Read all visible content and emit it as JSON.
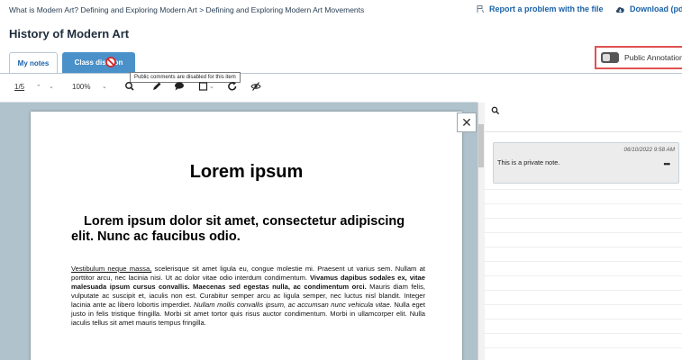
{
  "breadcrumb": "What is Modern Art? Defining and Exploring Modern Art > Defining and Exploring Modern Art Movements",
  "header": {
    "report_label": "Report a problem with the file",
    "download_label": "Download (pdf)"
  },
  "page_title": "History of Modern Art",
  "tabs": [
    {
      "label": "My notes",
      "active": true
    },
    {
      "label": "Class discussion",
      "label_visible": "Class disc  ion",
      "disabled": true
    }
  ],
  "tooltip": "Public comments are disabled for this item",
  "public_annotations_label": "Public Annotations",
  "toolbar": {
    "page_count": "1/5",
    "zoom": "100%",
    "icons": [
      "search-icon",
      "pen-icon",
      "comment-icon",
      "shape-icon",
      "rotate-icon",
      "hide-annotations-icon"
    ]
  },
  "document": {
    "title": "Lorem ipsum",
    "subtitle_line1": "Lorem ipsum dolor sit amet, consectetur adipiscing",
    "subtitle_line2": "elit. Nunc ac faucibus odio.",
    "para_underline": "Vestibulum neque massa,",
    "para_part1": " scelerisque sit amet ligula eu, congue molestie mi. Praesent ut varius sem. Nullam at porttitor arcu, nec lacinia nisi. Ut ac dolor vitae odio interdum condimentum. ",
    "para_bold": "Vivamus dapibus sodales ex, vitae malesuada ipsum cursus convallis. Maecenas sed egestas nulla, ac condimentum orci.",
    "para_part2": " Mauris diam felis, vulputate ac suscipit et, iaculis non est. Curabitur semper arcu ac ligula semper, nec luctus nisl blandit. Integer lacinia ante ac libero lobortis imperdiet. ",
    "para_italic": "Nullam mollis convallis ipsum, ac accumsan nunc vehicula vitae.",
    "para_part3": " Nulla eget justo in felis tristique fringilla. Morbi sit amet tortor quis risus auctor condimentum. Morbi in ullamcorper elit. Nulla iaculis tellus sit amet mauris tempus fringilla."
  },
  "note": {
    "date": "06/10/2022 9:58 AM",
    "text": "This is a private note.",
    "menu": "•••"
  },
  "colors": {
    "link": "#1b62a8",
    "tab_active_bg": "#4a90c9",
    "highlight_border": "#e05252",
    "viewer_bg": "#b0c2cc"
  }
}
